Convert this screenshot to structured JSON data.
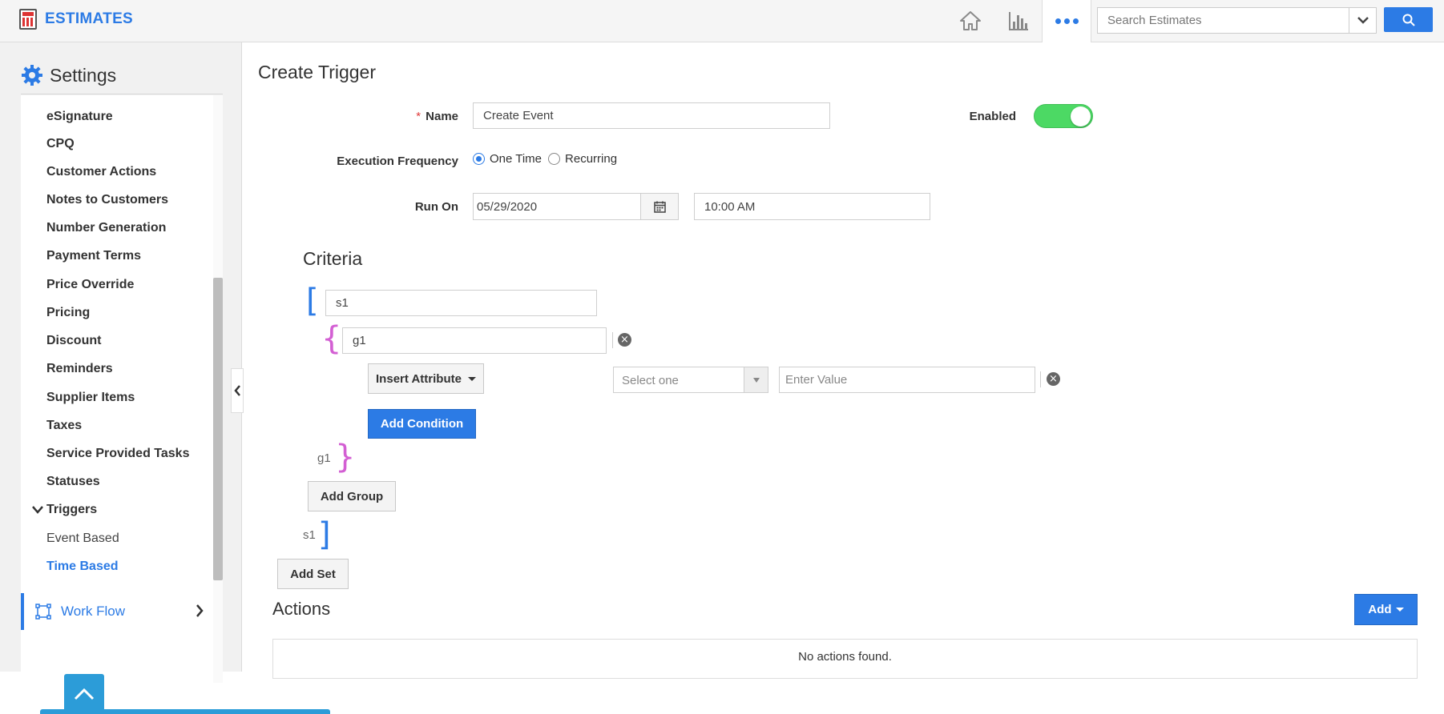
{
  "app": {
    "title": "ESTIMATES",
    "icons": [
      "calculator-icon",
      "home-icon",
      "chart-icon",
      "more-icon",
      "search-icon"
    ]
  },
  "search": {
    "placeholder": "Search Estimates"
  },
  "sidebar": {
    "title": "Settings",
    "items": [
      {
        "label": "eSignature"
      },
      {
        "label": "CPQ"
      },
      {
        "label": "Customer Actions"
      },
      {
        "label": "Notes to Customers"
      },
      {
        "label": "Number Generation"
      },
      {
        "label": "Payment Terms"
      },
      {
        "label": "Price Override"
      },
      {
        "label": "Pricing"
      },
      {
        "label": "Discount"
      },
      {
        "label": "Reminders"
      },
      {
        "label": "Supplier Items"
      },
      {
        "label": "Taxes"
      },
      {
        "label": "Service Provided Tasks"
      },
      {
        "label": "Statuses"
      },
      {
        "label": "Triggers",
        "expanded": true
      },
      {
        "label": "Event Based"
      },
      {
        "label": "Time Based",
        "active": true
      }
    ],
    "workflow_label": "Work Flow"
  },
  "form": {
    "title": "Create Trigger",
    "name_label": "Name",
    "name_value": "Create Event",
    "enabled_label": "Enabled",
    "enabled": true,
    "frequency_label": "Execution Frequency",
    "frequency_options": [
      "One Time",
      "Recurring"
    ],
    "frequency_selected": "One Time",
    "run_on_label": "Run On",
    "run_on_date": "05/29/2020",
    "run_on_time": "10:00 AM"
  },
  "criteria": {
    "title": "Criteria",
    "set_name": "s1",
    "group_name": "g1",
    "insert_attribute_label": "Insert Attribute",
    "select_placeholder": "Select one",
    "value_placeholder": "Enter Value",
    "add_condition_label": "Add Condition",
    "group_end_label": "g1",
    "add_group_label": "Add Group",
    "set_end_label": "s1",
    "add_set_label": "Add Set"
  },
  "actions": {
    "title": "Actions",
    "add_label": "Add",
    "empty_text": "No actions found."
  },
  "colors": {
    "accent": "#2c7be5",
    "toggle_on": "#4cd964",
    "group_brace": "#d35fd3"
  }
}
